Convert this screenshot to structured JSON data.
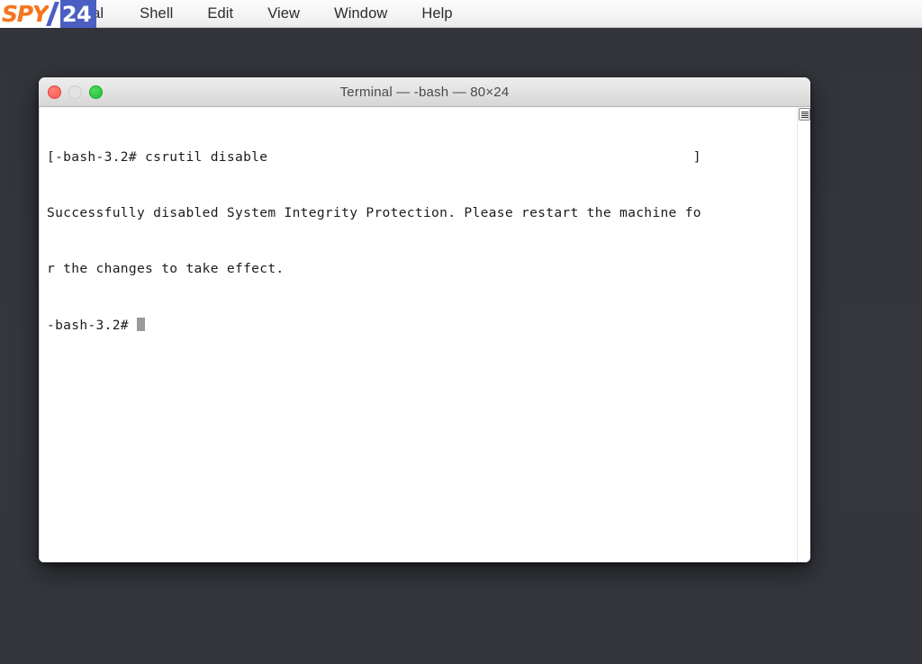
{
  "watermark": {
    "brand_text": "SPY",
    "number_text": "24",
    "brand_color": "#f47621",
    "badge_color": "#4a5fc1"
  },
  "menubar": {
    "items": [
      {
        "label": "Terminal",
        "name": "menu-terminal"
      },
      {
        "label": "Shell",
        "name": "menu-shell"
      },
      {
        "label": "Edit",
        "name": "menu-edit"
      },
      {
        "label": "View",
        "name": "menu-view"
      },
      {
        "label": "Window",
        "name": "menu-window"
      },
      {
        "label": "Help",
        "name": "menu-help"
      }
    ]
  },
  "window": {
    "title": "Terminal — -bash — 80×24",
    "traffic_lights": {
      "close_label": "close",
      "minimize_label": "minimize",
      "maximize_label": "maximize",
      "close_color": "#fa5a50",
      "minimize_color": "#e3e3e3",
      "maximize_color": "#1fbf34"
    },
    "scrollbar": {
      "thumb_name": "scrollbar-thumb"
    }
  },
  "terminal": {
    "lines": [
      "[-bash-3.2# csrutil disable                                                    ]",
      "Successfully disabled System Integrity Protection. Please restart the machine fo",
      "r the changes to take effect.",
      "-bash-3.2# "
    ],
    "prompt": "-bash-3.2#",
    "command": "csrutil disable",
    "output": "Successfully disabled System Integrity Protection. Please restart the machine for the changes to take effect.",
    "cursor_visible": true
  }
}
